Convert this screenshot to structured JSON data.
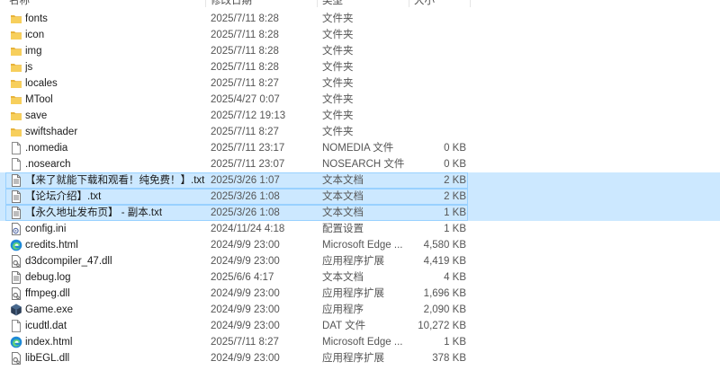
{
  "header": {
    "name": "名称",
    "date": "修改日期",
    "type": "类型",
    "size": "大小"
  },
  "colors": {
    "folder": "#f0c146",
    "selection": "#cce8ff",
    "edge": "#1f8ad6"
  },
  "rows": [
    {
      "name": "fonts",
      "date": "2025/7/11 8:28",
      "type": "文件夹",
      "size": "",
      "icon": "folder-icon",
      "selected": false
    },
    {
      "name": "icon",
      "date": "2025/7/11 8:28",
      "type": "文件夹",
      "size": "",
      "icon": "folder-icon",
      "selected": false
    },
    {
      "name": "img",
      "date": "2025/7/11 8:28",
      "type": "文件夹",
      "size": "",
      "icon": "folder-icon",
      "selected": false
    },
    {
      "name": "js",
      "date": "2025/7/11 8:28",
      "type": "文件夹",
      "size": "",
      "icon": "folder-icon",
      "selected": false
    },
    {
      "name": "locales",
      "date": "2025/7/11 8:27",
      "type": "文件夹",
      "size": "",
      "icon": "folder-icon",
      "selected": false
    },
    {
      "name": "MTool",
      "date": "2025/4/27 0:07",
      "type": "文件夹",
      "size": "",
      "icon": "folder-icon",
      "selected": false
    },
    {
      "name": "save",
      "date": "2025/7/12 19:13",
      "type": "文件夹",
      "size": "",
      "icon": "folder-icon",
      "selected": false
    },
    {
      "name": "swiftshader",
      "date": "2025/7/11 8:27",
      "type": "文件夹",
      "size": "",
      "icon": "folder-icon",
      "selected": false
    },
    {
      "name": ".nomedia",
      "date": "2025/7/11 23:17",
      "type": "NOMEDIA 文件",
      "size": "0 KB",
      "icon": "blank-file-icon",
      "selected": false
    },
    {
      "name": ".nosearch",
      "date": "2025/7/11 23:07",
      "type": "NOSEARCH 文件",
      "size": "0 KB",
      "icon": "blank-file-icon",
      "selected": false
    },
    {
      "name": "【来了就能下载和观看！纯免费！】.txt",
      "date": "2025/3/26 1:07",
      "type": "文本文档",
      "size": "2 KB",
      "icon": "text-file-icon",
      "selected": true
    },
    {
      "name": "【论坛介绍】.txt",
      "date": "2025/3/26 1:08",
      "type": "文本文档",
      "size": "2 KB",
      "icon": "text-file-icon",
      "selected": true
    },
    {
      "name": "【永久地址发布页】 - 副本.txt",
      "date": "2025/3/26 1:08",
      "type": "文本文档",
      "size": "1 KB",
      "icon": "text-file-icon",
      "selected": true
    },
    {
      "name": "config.ini",
      "date": "2024/11/24 4:18",
      "type": "配置设置",
      "size": "1 KB",
      "icon": "settings-file-icon",
      "selected": false
    },
    {
      "name": "credits.html",
      "date": "2024/9/9 23:00",
      "type": "Microsoft Edge ...",
      "size": "4,580 KB",
      "icon": "edge-icon",
      "selected": false
    },
    {
      "name": "d3dcompiler_47.dll",
      "date": "2024/9/9 23:00",
      "type": "应用程序扩展",
      "size": "4,419 KB",
      "icon": "dll-file-icon",
      "selected": false
    },
    {
      "name": "debug.log",
      "date": "2025/6/6 4:17",
      "type": "文本文档",
      "size": "4 KB",
      "icon": "text-file-icon",
      "selected": false
    },
    {
      "name": "ffmpeg.dll",
      "date": "2024/9/9 23:00",
      "type": "应用程序扩展",
      "size": "1,696 KB",
      "icon": "dll-file-icon",
      "selected": false
    },
    {
      "name": "Game.exe",
      "date": "2024/9/9 23:00",
      "type": "应用程序",
      "size": "2,090 KB",
      "icon": "exe-icon",
      "selected": false
    },
    {
      "name": "icudtl.dat",
      "date": "2024/9/9 23:00",
      "type": "DAT 文件",
      "size": "10,272 KB",
      "icon": "blank-file-icon",
      "selected": false
    },
    {
      "name": "index.html",
      "date": "2025/7/11 8:27",
      "type": "Microsoft Edge ...",
      "size": "1 KB",
      "icon": "edge-icon",
      "selected": false
    },
    {
      "name": "libEGL.dll",
      "date": "2024/9/9 23:00",
      "type": "应用程序扩展",
      "size": "378 KB",
      "icon": "dll-file-icon",
      "selected": false
    }
  ]
}
